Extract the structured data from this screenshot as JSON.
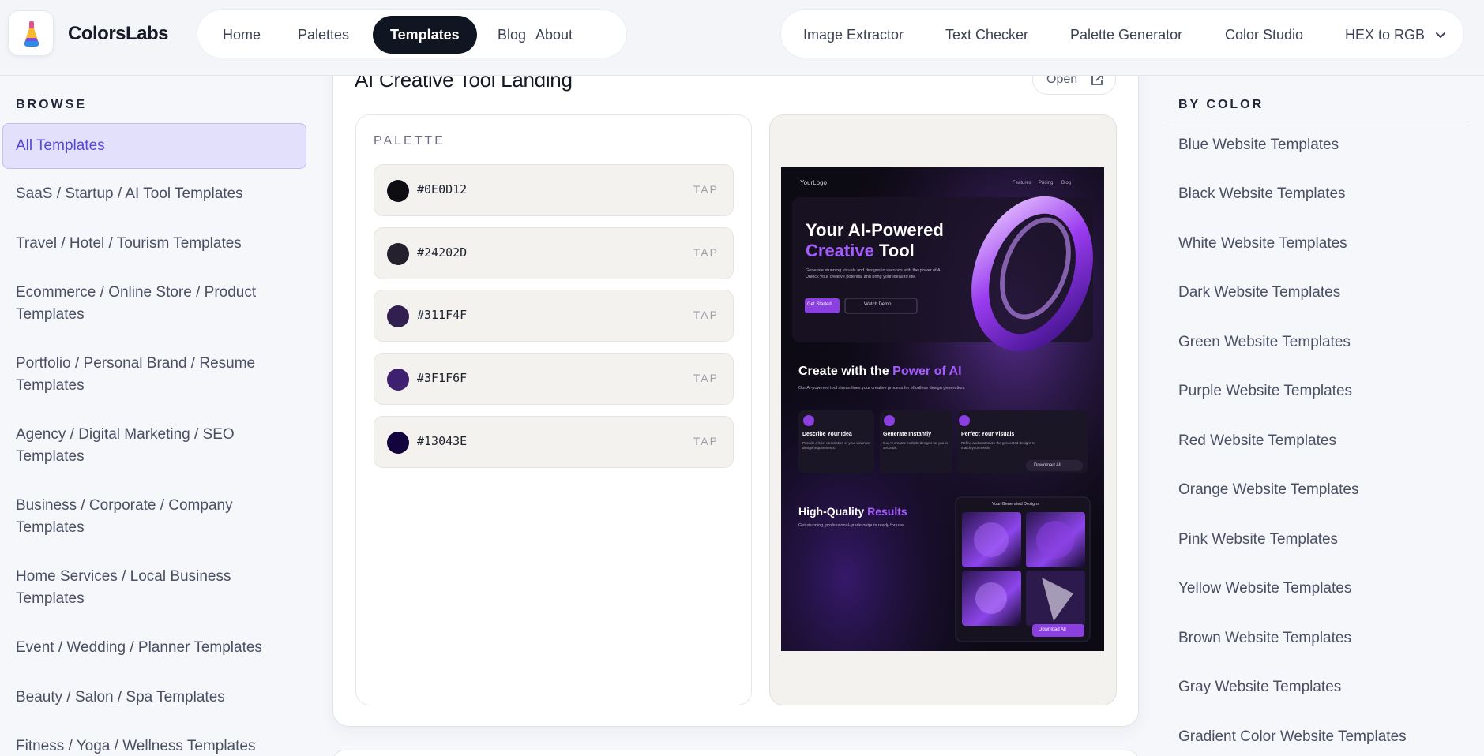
{
  "header": {
    "brand": "ColorsLabs",
    "nav": [
      "Home",
      "Palettes",
      "Templates",
      "Blog",
      "About"
    ],
    "active_nav": "Templates",
    "tools": [
      "Image Extractor",
      "Text Checker",
      "Palette Generator",
      "Color Studio",
      "HEX to RGB"
    ]
  },
  "browse": {
    "heading": "BROWSE",
    "items": [
      "All Templates",
      "SaaS / Startup / AI Tool Templates",
      "Travel / Hotel / Tourism Templates",
      "Ecommerce / Online Store / Product Templates",
      "Portfolio / Personal Brand / Resume Templates",
      "Agency / Digital Marketing / SEO Templates",
      "Business / Corporate / Company Templates",
      "Home Services / Local Business Templates",
      "Event / Wedding / Planner Templates",
      "Beauty / Salon / Spa Templates",
      "Fitness / Yoga / Wellness Templates"
    ]
  },
  "template": {
    "title": "AI Creative Tool Landing",
    "open_label": "Open",
    "palette_label": "PALETTE",
    "tap_label": "TAP",
    "swatches": [
      "#0E0D12",
      "#24202D",
      "#311F4F",
      "#3F1F6F",
      "#13043E"
    ]
  },
  "preview": {
    "logo": "YourLogo",
    "nav": [
      "Features",
      "Pricing",
      "Blog"
    ],
    "hero_title_1": "Your AI-Powered",
    "hero_title_accent": "Creative",
    "hero_title_2": "Tool",
    "hero_text": "Generate stunning visuals and designs in seconds with the power of AI. Unlock your creative potential and bring your ideas to life.",
    "btn_primary": "Get Started",
    "btn_secondary": "Watch Demo",
    "section_title": "Create with the",
    "section_accent": "Power of AI",
    "section_text": "Our AI-powered tool streamlines your creative process for effortless design generation.",
    "features": [
      {
        "title": "Describe Your Idea",
        "text": "Provide a brief description of your vision or design requirements."
      },
      {
        "title": "Generate Instantly",
        "text": "Our AI creates multiple designs for you in seconds."
      },
      {
        "title": "Perfect Your Visuals",
        "text": "Refine and customize the generated designs to match your needs."
      }
    ],
    "download_all": "Download All",
    "quality_title": "High-Quality",
    "quality_accent": "Results",
    "quality_text": "Get stunning, professional-grade outputs ready for use.",
    "gallery_title": "Your Generated Designs",
    "gallery_btn": "Download All"
  },
  "by_color": {
    "heading": "BY COLOR",
    "items": [
      "Blue Website Templates",
      "Black Website Templates",
      "White Website Templates",
      "Dark Website Templates",
      "Green Website Templates",
      "Purple Website Templates",
      "Red Website Templates",
      "Orange Website Templates",
      "Pink Website Templates",
      "Yellow Website Templates",
      "Brown Website Templates",
      "Gray Website Templates",
      "Gradient Color Website Templates"
    ]
  },
  "colors": {
    "accent": "#5548d8",
    "active_bg": "#e3e0fb",
    "nav_active": "#101522",
    "preview_purple": "#8b3fe0"
  }
}
